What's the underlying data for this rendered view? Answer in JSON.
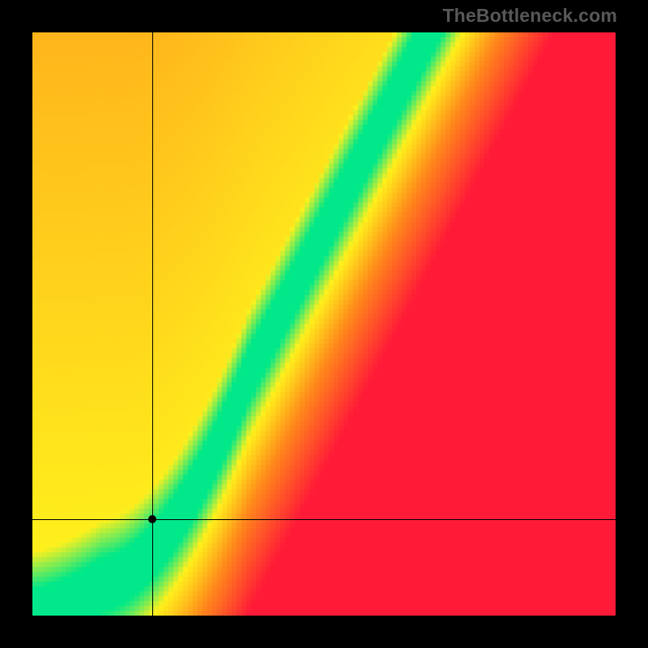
{
  "watermark": "TheBottleneck.com",
  "chart_data": {
    "type": "heatmap",
    "title": "",
    "xlabel": "",
    "ylabel": "",
    "xlim": [
      0,
      1
    ],
    "ylim": [
      0,
      1
    ],
    "grid_n": 120,
    "optimal_curve_poly": [
      0.18,
      1.95,
      0.55,
      0.0
    ],
    "band_halfwidth": 0.045,
    "yellow_halfwidth": 0.11,
    "colors": {
      "red": "#ff1a38",
      "orange": "#ff8a1b",
      "yellow": "#fff11d",
      "green": "#00e88a"
    },
    "crosshair": {
      "x": 0.205,
      "y": 0.165
    }
  }
}
